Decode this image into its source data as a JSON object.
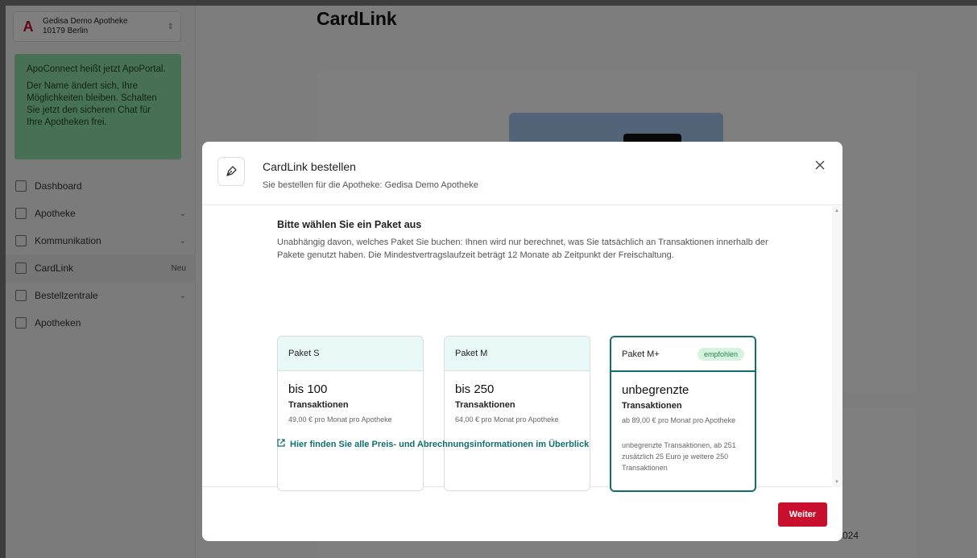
{
  "sidebar": {
    "pharmacy": {
      "name": "Gedisa Demo Apotheke",
      "address": "10179 Berlin"
    },
    "notice": {
      "title": "ApoConnect heißt jetzt ApoPortal.",
      "text": "Der Name ändert sich, Ihre Möglichkeiten bleiben. Schalten Sie jetzt den sicheren Chat für Ihre Apotheken frei."
    },
    "nav": [
      {
        "label": "Dashboard",
        "icon": "dashboard-icon"
      },
      {
        "label": "Apotheke",
        "icon": "home-icon",
        "expandable": true
      },
      {
        "label": "Kommunikation",
        "icon": "chat-icon",
        "expandable": true
      },
      {
        "label": "CardLink",
        "icon": "card-icon",
        "badge": "Neu",
        "active": true
      },
      {
        "label": "Bestellzentrale",
        "icon": "cart-icon",
        "expandable": true
      },
      {
        "label": "Apotheken",
        "icon": "building-icon"
      }
    ]
  },
  "main": {
    "title": "CardLink",
    "fragment": "024"
  },
  "modal": {
    "title": "CardLink bestellen",
    "subtitle": "Sie bestellen für die Apotheke: Gedisa Demo Apotheke",
    "section_title": "Bitte wählen Sie ein Paket aus",
    "section_desc": "Unabhängig davon, welches Paket Sie buchen: Ihnen wird nur berechnet, was Sie tatsächlich an Transaktionen innerhalb der Pakete genutzt haben. Die Mindestvertragslaufzeit beträgt 12 Monate ab Zeitpunkt der Freischaltung.",
    "packages": [
      {
        "name": "Paket S",
        "amount": "bis 100",
        "unit": "Transaktionen",
        "price": "49,00 € pro Monat pro Apotheke"
      },
      {
        "name": "Paket M",
        "amount": "bis 250",
        "unit": "Transaktionen",
        "price": "64,00 € pro Monat pro Apotheke"
      },
      {
        "name": "Paket M+",
        "badge": "empfohlen",
        "amount": "unbegrenzte",
        "unit": "Transaktionen",
        "price": "ab 89,00 € pro Monat pro Apotheke",
        "extra": "unbegrenzte Transaktionen, ab 251 zusätzlich 25 Euro je weitere 250 Transaktionen",
        "selected": true
      }
    ],
    "info_link": "Hier finden Sie alle Preis- und Abrechnungsinformationen im Überblick",
    "continue_label": "Weiter"
  },
  "colors": {
    "accent": "#0f6e6e",
    "primary_button": "#c8102e",
    "badge_bg": "#d6f2e0",
    "badge_text": "#2b8a4e"
  }
}
